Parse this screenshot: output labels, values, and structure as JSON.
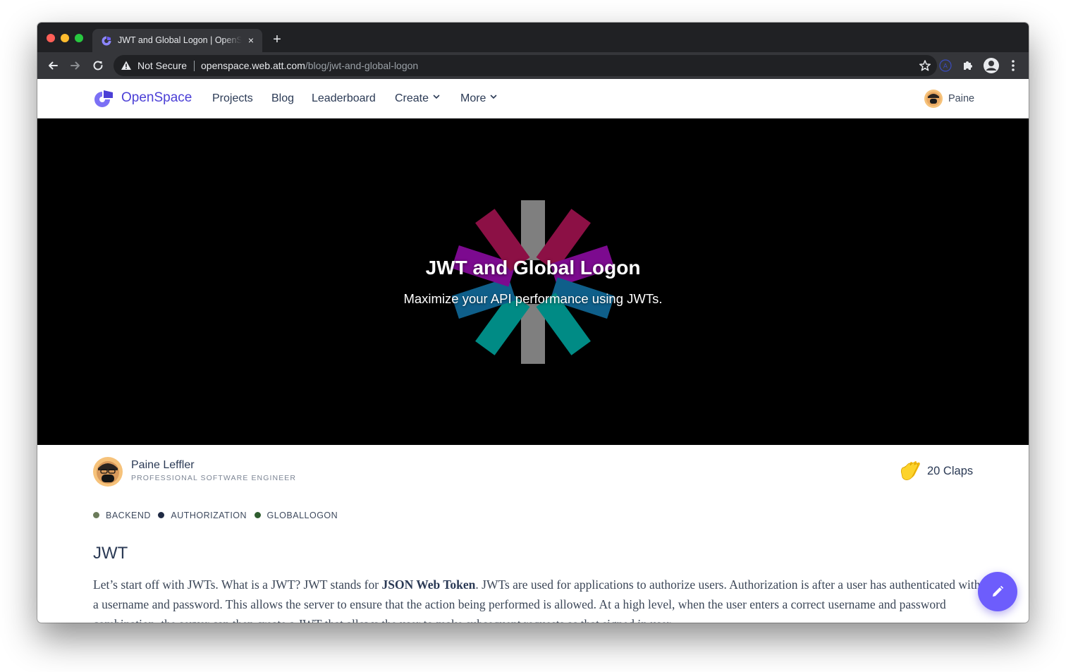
{
  "browser": {
    "tab_title": "JWT and Global Logon | OpenSpace",
    "tab_close": "×",
    "new_tab": "+",
    "security_label": "Not Secure",
    "url_host": "openspace.web.att.com",
    "url_path": "/blog/jwt-and-global-logon",
    "icons": [
      "back-icon",
      "forward-icon",
      "reload-icon",
      "warning-icon",
      "star-icon",
      "account-extension-icon",
      "puzzle-icon",
      "profile-icon",
      "kebab-menu-icon"
    ]
  },
  "site": {
    "brand": "OpenSpace",
    "brand_color": "#4b3fd6",
    "nav": {
      "projects": "Projects",
      "blog": "Blog",
      "leaderboard": "Leaderboard",
      "create": "Create",
      "more": "More"
    },
    "user_name": "Paine"
  },
  "hero": {
    "title": "JWT and Global Logon",
    "subtitle": "Maximize your API performance using JWTs."
  },
  "article": {
    "author_name": "Paine Leffler",
    "author_role": "PROFESSIONAL SOFTWARE ENGINEER",
    "claps": "20 Claps",
    "tags": [
      {
        "label": "BACKEND",
        "color": "#6b7b5a"
      },
      {
        "label": "AUTHORIZATION",
        "color": "#1f2a44"
      },
      {
        "label": "GLOBALLOGON",
        "color": "#2f5d2f"
      }
    ],
    "section_title": "JWT",
    "para_1": "Let’s start off with JWTs. What is a JWT? JWT stands for ",
    "para_bold": "JSON Web Token",
    "para_2": ". JWTs are used for applications to authorize users. Authorization is after a user has authenticated with a username and password. This allows the server to ensure that the action being performed is allowed. At a high level, when the user enters a correct username and password combination, the server can then create a JWT that allows the user to make subsequent requests as that signed in user."
  },
  "fab_icon": "pencil-icon",
  "accent": "#6d5dfc"
}
